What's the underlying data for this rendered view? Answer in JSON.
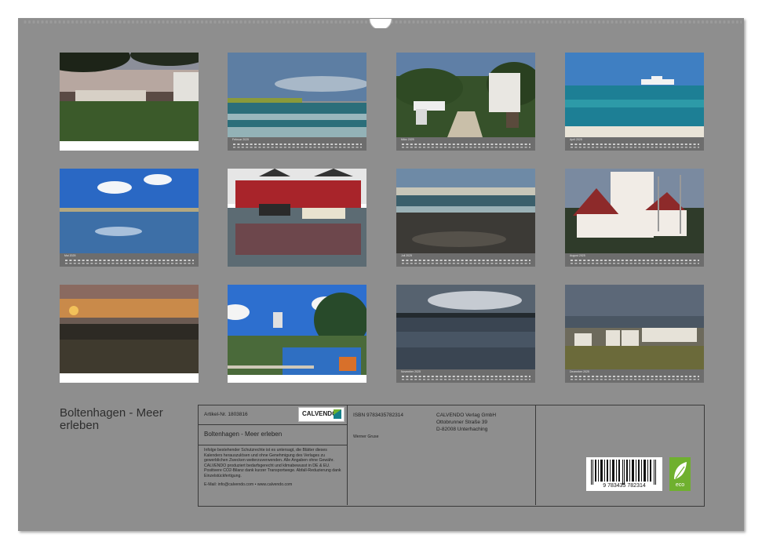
{
  "calendar": {
    "title": "Boltenhagen - Meer erleben",
    "months": [
      {
        "label": ""
      },
      {
        "label": "Februar 2025"
      },
      {
        "label": "März 2025"
      },
      {
        "label": "April 2025"
      },
      {
        "label": "Mai 2025"
      },
      {
        "label": ""
      },
      {
        "label": "Juli 2025"
      },
      {
        "label": "August 2025"
      },
      {
        "label": ""
      },
      {
        "label": ""
      },
      {
        "label": "November 2025"
      },
      {
        "label": "Dezember 2025"
      }
    ]
  },
  "info": {
    "article": "Artikel-Nr. 1803816",
    "isbn": "ISBN 9783435782314",
    "publisher_name": "CALVENDO Verlag GmbH",
    "publisher_street": "Ottobrunner Straße 39",
    "publisher_city": "D-82008 Unterhaching",
    "subtitle": "Boltenhagen - Meer erleben",
    "author": "Werner Gruse",
    "legal": "Infolge bestehender Schutzrechte ist es untersagt, die Blätter dieses Kalenders herauszulösen und ohne Genehmigung des Verlages zu gewerblichen Zwecken weiterzuverwenden. Alle Angaben ohne Gewähr. CALVENDO produziert bedarfsgerecht und klimabewusst in DE & EU. Positivere CO2-Bilanz dank kurzer Transportwege. Abfall-Reduzierung dank Einzelstückfertigung.",
    "contact": "E-Mail: info@calvendo.com • www.calvendo.com",
    "logo_text": "CALVENDO",
    "barcode_digits": "9 783435 782314",
    "eco_label": "eco"
  },
  "colors": {
    "page_bg": "#8e8e8e",
    "strip": "#6d6d6d",
    "eco_green": "#6fb02f",
    "logo_teal": "#16808a"
  }
}
